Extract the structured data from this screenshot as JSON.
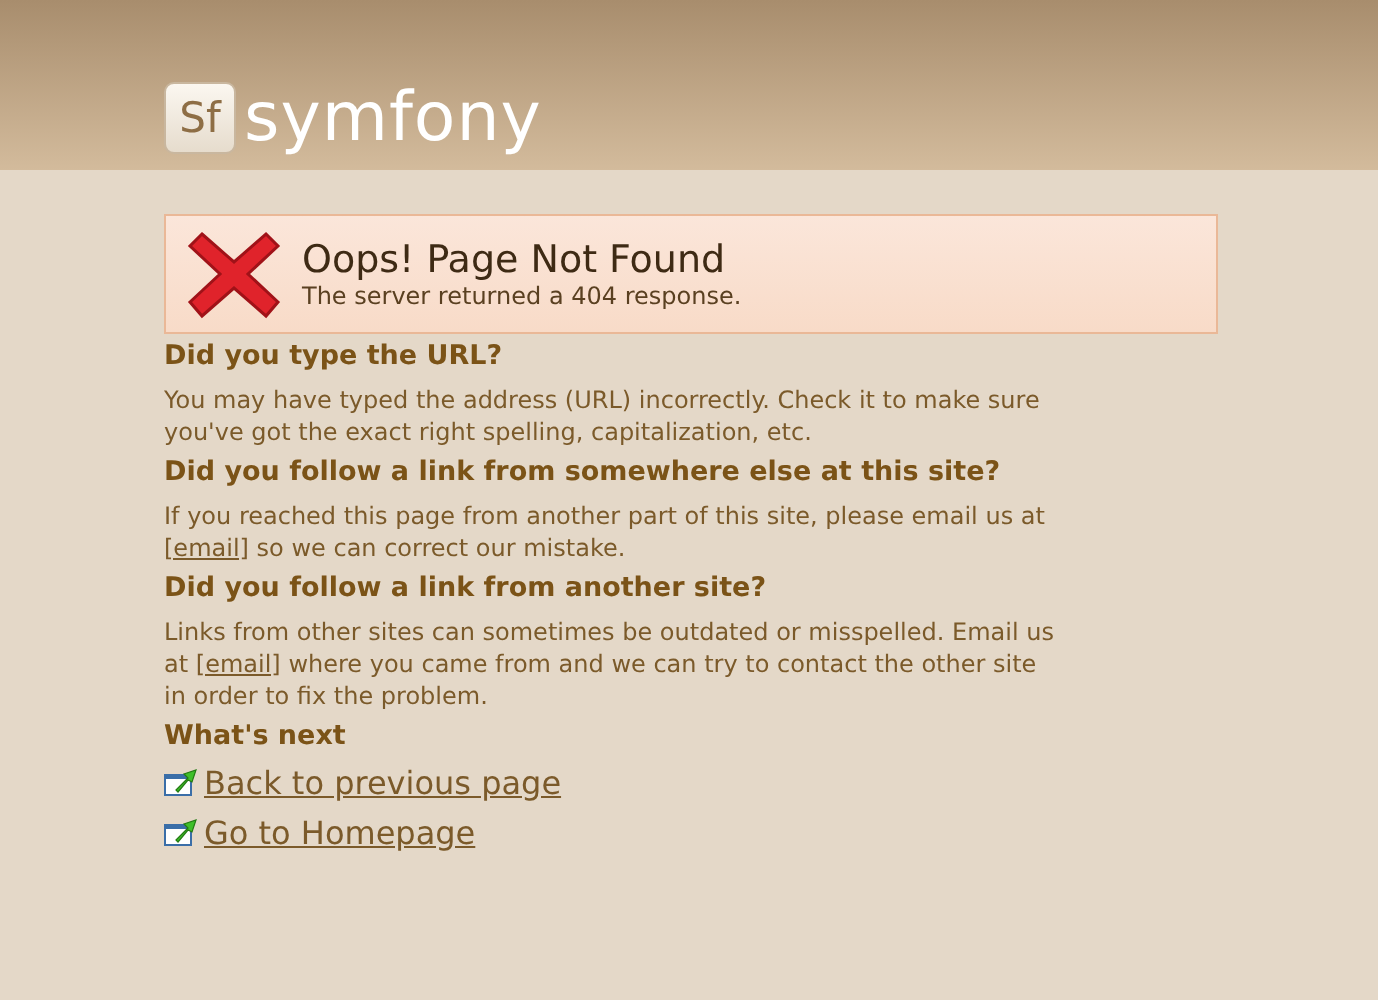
{
  "header": {
    "logo_mark": "Sf",
    "logo_text": "symfony"
  },
  "error_box": {
    "title": "Oops! Page Not Found",
    "message": "The server returned a 404 response."
  },
  "sections": [
    {
      "heading": "Did you type the URL?",
      "before": "You may have typed the address (URL) incorrectly. Check it to make sure you've got the exact right spelling, capitalization, etc."
    },
    {
      "heading": "Did you follow a link from somewhere else at this site?",
      "before": "If you reached this page from another part of this site, please email us at",
      "link": "[email]",
      "after": "so we can correct our mistake."
    },
    {
      "heading": "Did you follow a link from another site?",
      "before": "Links from other sites can sometimes be outdated or misspelled. Email us at",
      "link": "[email]",
      "after": "where you came from and we can try to contact the other site in order to fix the problem."
    }
  ],
  "next": {
    "heading": "What's next",
    "links": [
      "Back to previous page",
      "Go to Homepage"
    ]
  }
}
